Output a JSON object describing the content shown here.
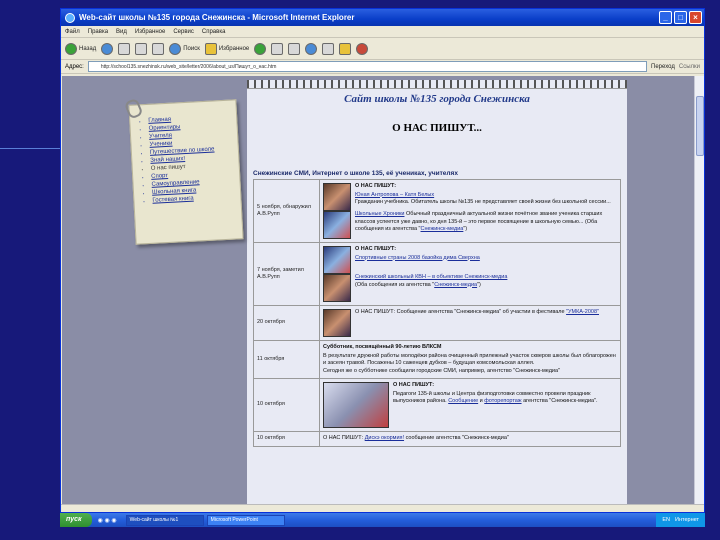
{
  "window": {
    "title": "Web-сайт школы №135 города Снежинска - Microsoft Internet Explorer",
    "buttons": [
      "_",
      "□",
      "×"
    ]
  },
  "menubar": [
    "Файл",
    "Правка",
    "Вид",
    "Избранное",
    "Сервис",
    "Справка"
  ],
  "toolbar": {
    "back": "Назад",
    "search": "Поиск",
    "favorites": "Избранное"
  },
  "addressbar": {
    "label": "Адрес:",
    "url": "http://school135.snezhinsk.ru/web_site/letter/2006/about_us/Пишут_о_нас.htm",
    "go": "Переход",
    "links": "Ссылки"
  },
  "page": {
    "site_title": "Сайт школы №135 города Снежинска",
    "about_title": "О НАС ПИШУТ...",
    "section_heading": "Снежинские СМИ, Интернет о школе 135, её учениках, учителях"
  },
  "nav_menu": [
    "Главная",
    "Ориентиры",
    "Учителя",
    "Ученики",
    "Путешествие по школе",
    "Знай наших!",
    "О нас пишут",
    "Спорт",
    "Самоуправление",
    "Школьная книга",
    "Гостевая книга"
  ],
  "rows": [
    {
      "date": "5 ноября, обнаружил А.В.Рупп",
      "heading": "О НАС ПИШУТ:",
      "link1": "Юная Антропова – Катя Белых",
      "text1": "Гражданин учебника. Обитатель школы №135 не представляет своей жизни без школьной сессии...",
      "link2": "Школьные Хроники",
      "text2": "Обычный праздничный актуальной жизни почётное звание ученика старших классов успеется уже давно, ко дня 135-й – это первое посвящение в школьную семью...",
      "source": "Снежинск-медиа"
    },
    {
      "date": "7 ноября, заметил А.В.Рупп",
      "heading": "О НАС ПИШУТ:",
      "link1": "Спортивные страны 2008 базойка дима Сверхна",
      "link2": "Снежинский школьный КВН – в объективе Снежинск-медиа",
      "source": "Снежинск-медиа"
    },
    {
      "date": "20 октября",
      "text": "О НАС ПИШУТ: Сообщение агентства \"Снежинск-медиа\" об участии в фестивале",
      "link": "\"УМКА-2008\""
    },
    {
      "date": "11 октября",
      "heading": "Субботник, посвящённый 90-летию ВЛКСМ",
      "text1": "В результате дружной работы молодёжи района очищенный прилежный участок скверов школы был облагорожен и засеян травой. Посажены 10 саженцев дубков – будущая комсомольская аллея.",
      "link": "облагорожен",
      "text2": "Сегодня же о субботнике сообщили городские СМИ, например, агентство \"Снежинск-медиа\""
    },
    {
      "date": "10 октября",
      "heading": "О НАС ПИШУТ:",
      "text": "Педагоги 135-й школы и Центра физподготовки совместно провели праздник выпускников района.",
      "link1": "Сообщение",
      "link2": "фоторепортаж",
      "source": "агентства \"Снежинск-медиа\"."
    },
    {
      "date": "10 октября",
      "text1": "О НАС ПИШУТ:",
      "link": "Дискэ окормия!",
      "text2": "сообщение агентства \"Снежинск-медиа\""
    }
  ],
  "taskbar": {
    "start": "пуск",
    "tasks": [
      "Web-сайт школы №1",
      "Microsoft PowerPoint"
    ],
    "tray": [
      "EN",
      "Интернет"
    ]
  }
}
